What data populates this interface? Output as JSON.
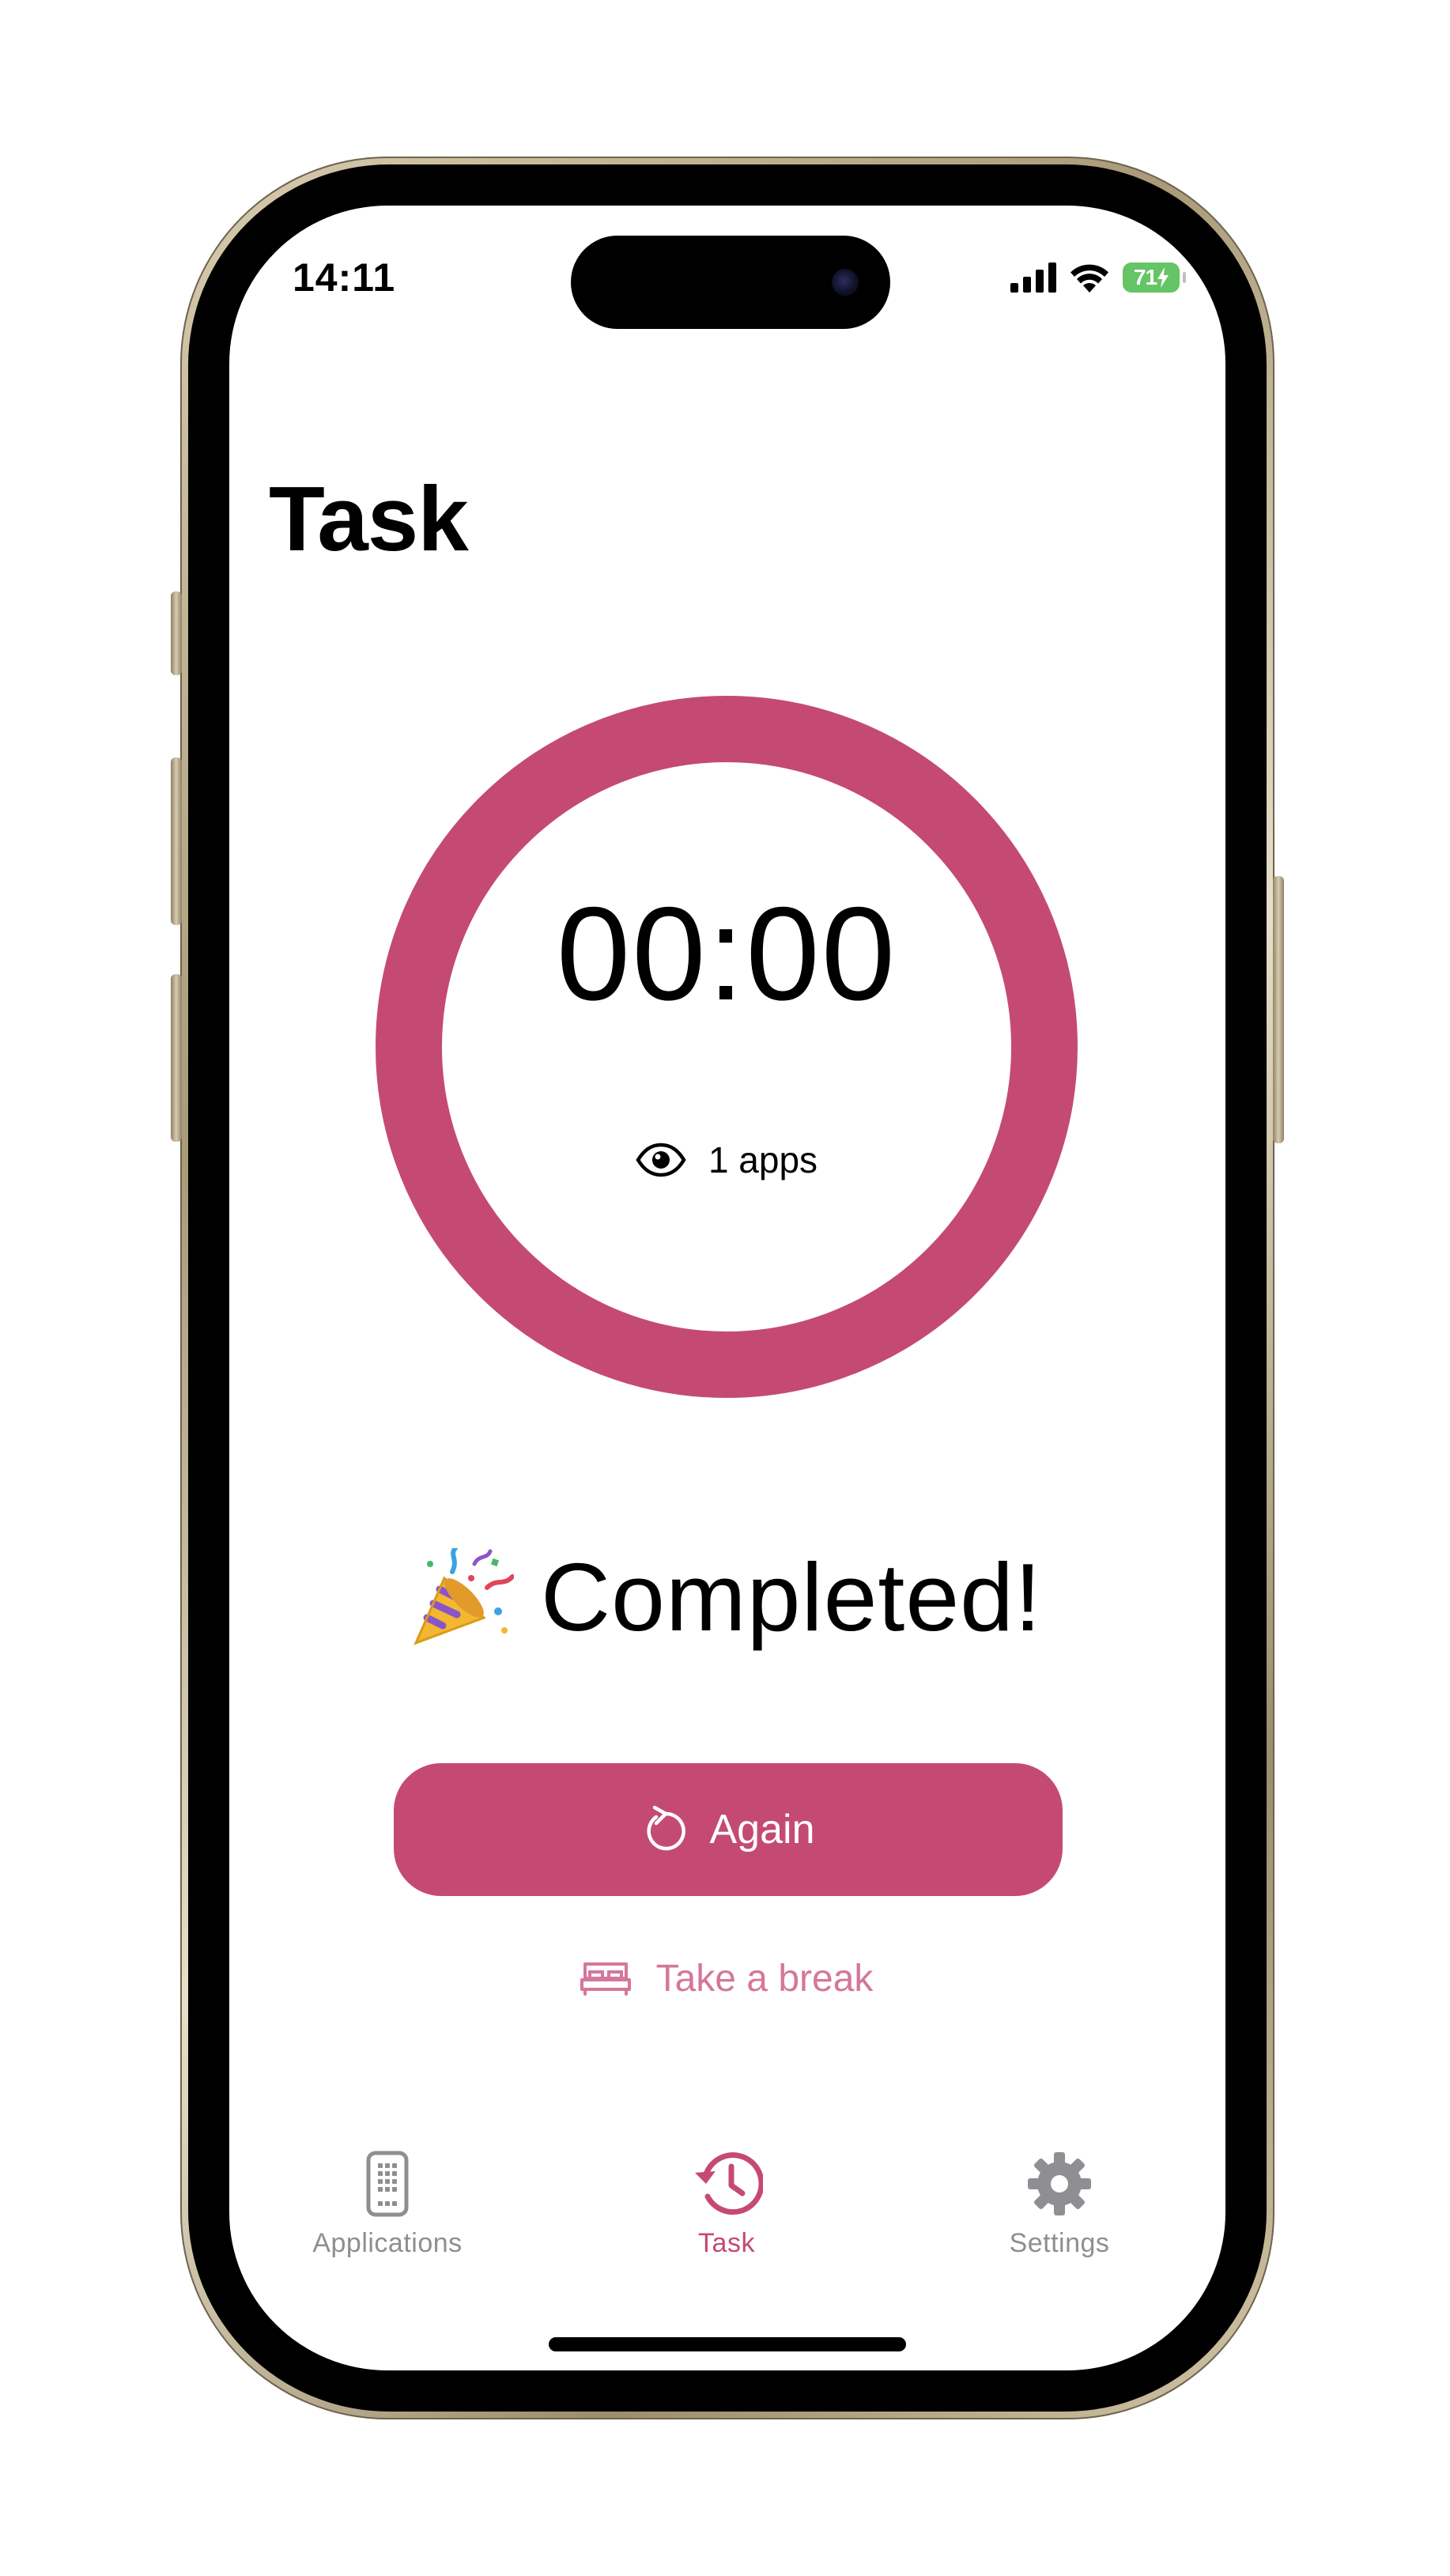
{
  "status_bar": {
    "time": "14:11",
    "battery_level": "71"
  },
  "header": {
    "title": "Task"
  },
  "timer": {
    "display": "00:00",
    "progress": 1.0,
    "ring_color": "#c44a74",
    "monitored_apps": "1 apps"
  },
  "result": {
    "emoji": "🎉",
    "message": "Completed!"
  },
  "actions": {
    "again_label": "Again",
    "break_label": "Take a break"
  },
  "tabbar": {
    "tabs": [
      {
        "label": "Applications",
        "icon": "phone-apps-icon",
        "active": false
      },
      {
        "label": "Task",
        "icon": "history-clock-icon",
        "active": true
      },
      {
        "label": "Settings",
        "icon": "gear-icon",
        "active": false
      }
    ],
    "active_color": "#c44a74",
    "inactive_color": "#8e8e93"
  },
  "colors": {
    "accent": "#c44a74",
    "accent_light": "#d4779a",
    "battery_green": "#65c466"
  }
}
